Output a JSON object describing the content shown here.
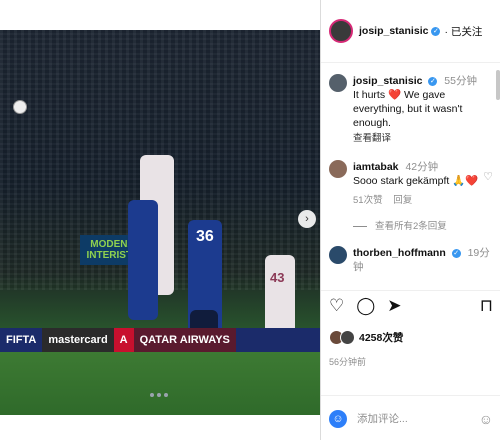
{
  "photo": {
    "sign_text": "MODENA INTERISTA",
    "board": [
      "FIFTA",
      "mastercard",
      "A",
      "QATAR AIRWAYS"
    ],
    "numbers": [
      "36",
      "43"
    ]
  },
  "post": {
    "username": "josip_stanisic",
    "verified": "✓",
    "follow_status": "· 已关注"
  },
  "comments": [
    {
      "user": "josip_stanisic",
      "time": "55分钟",
      "text": "It hurts ❤️ We gave everything, but it wasn't enough.",
      "action": "查看翻译"
    },
    {
      "user": "iamtabak",
      "time": "42分钟",
      "text": "Sooo stark gekämpft 🙏❤️",
      "likes": "51次赞",
      "reply": "回复"
    }
  ],
  "view_replies": "查看所有2条回复",
  "next_comment": {
    "user": "thorben_hoffmann",
    "time": "19分钟"
  },
  "likes_count": "4258次赞",
  "posted_ago": "56分钟前",
  "composer_placeholder": "添加评论..."
}
